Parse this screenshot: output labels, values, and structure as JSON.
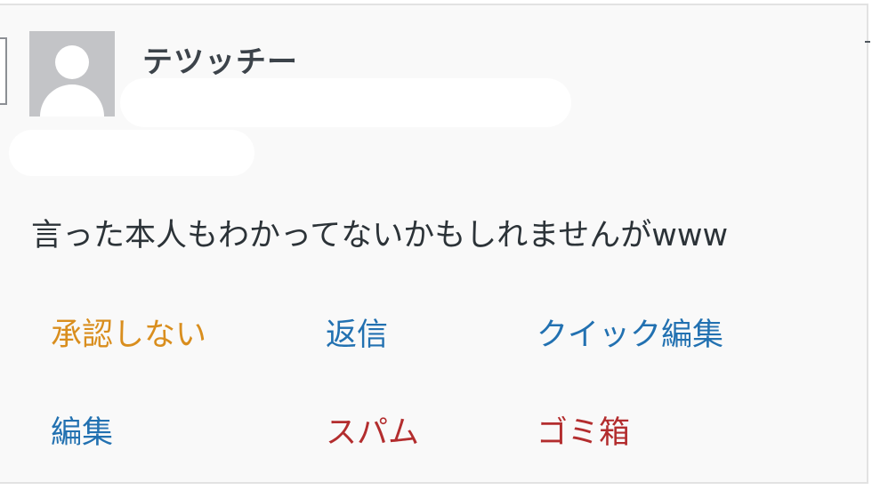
{
  "comment": {
    "author": "テツッチー",
    "text": "言った本人もわかってないかもしれませんがwww"
  },
  "actions": {
    "unapprove": "承認しない",
    "reply": "返信",
    "quick_edit": "クイック編集",
    "edit": "編集",
    "spam": "スパム",
    "trash": "ゴミ箱"
  },
  "colors": {
    "unapprove": "#d98e1e",
    "link": "#2271b1",
    "danger": "#b32d2e",
    "avatar_bg": "#c3c4c7"
  },
  "icons": {
    "avatar": "default-user-avatar"
  }
}
